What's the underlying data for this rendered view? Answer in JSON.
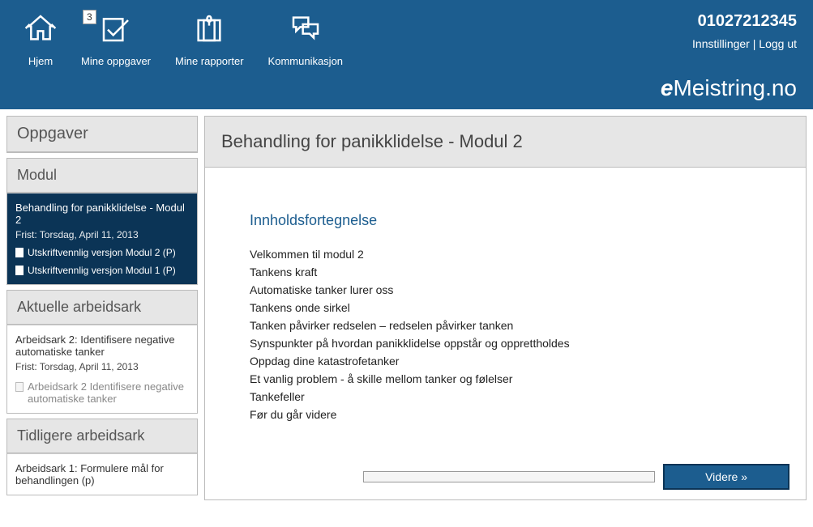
{
  "header": {
    "nav": [
      {
        "label": "Hjem"
      },
      {
        "label": "Mine oppgaver",
        "badge": "3"
      },
      {
        "label": "Mine rapporter"
      },
      {
        "label": "Kommunikasjon"
      }
    ],
    "user_id": "01027212345",
    "settings_label": "Innstillinger",
    "logout_label": "Logg ut",
    "brand_prefix": "e",
    "brand_text": "Meistring.no"
  },
  "sidebar": {
    "tasks_title": "Oppgaver",
    "module_title": "Modul",
    "module_item": {
      "title": "Behandling for panikklidelse - Modul 2",
      "deadline": "Frist: Torsdag, April 11, 2013",
      "links": [
        "Utskriftvennlig versjon Modul 2 (P)",
        "Utskriftvennlig versjon Modul 1 (P)"
      ]
    },
    "current_title": "Aktuelle arbeidsark",
    "current_item": {
      "title": "Arbeidsark 2: Identifisere negative automatiske tanker",
      "deadline": "Frist: Torsdag, April 11, 2013",
      "gray_link": "Arbeidsark 2 Identifisere negative automatiske tanker"
    },
    "previous_title": "Tidligere arbeidsark",
    "previous_item": {
      "title": "Arbeidsark 1: Formulere mål for behandlingen (p)"
    }
  },
  "main": {
    "title": "Behandling for panikklidelse - Modul 2",
    "toc_title": "Innholdsfortegnelse",
    "toc": [
      "Velkommen til modul 2",
      "Tankens kraft",
      "Automatiske tanker lurer oss",
      "Tankens onde sirkel",
      "Tanken påvirker redselen – redselen påvirker tanken",
      "Synspunkter på hvordan panikklidelse oppstår og opprettholdes",
      "Oppdag dine katastrofetanker",
      "Et vanlig problem - å skille mellom tanker og følelser",
      "Tankefeller",
      "Før du går videre"
    ],
    "next_button": "Videre »"
  }
}
